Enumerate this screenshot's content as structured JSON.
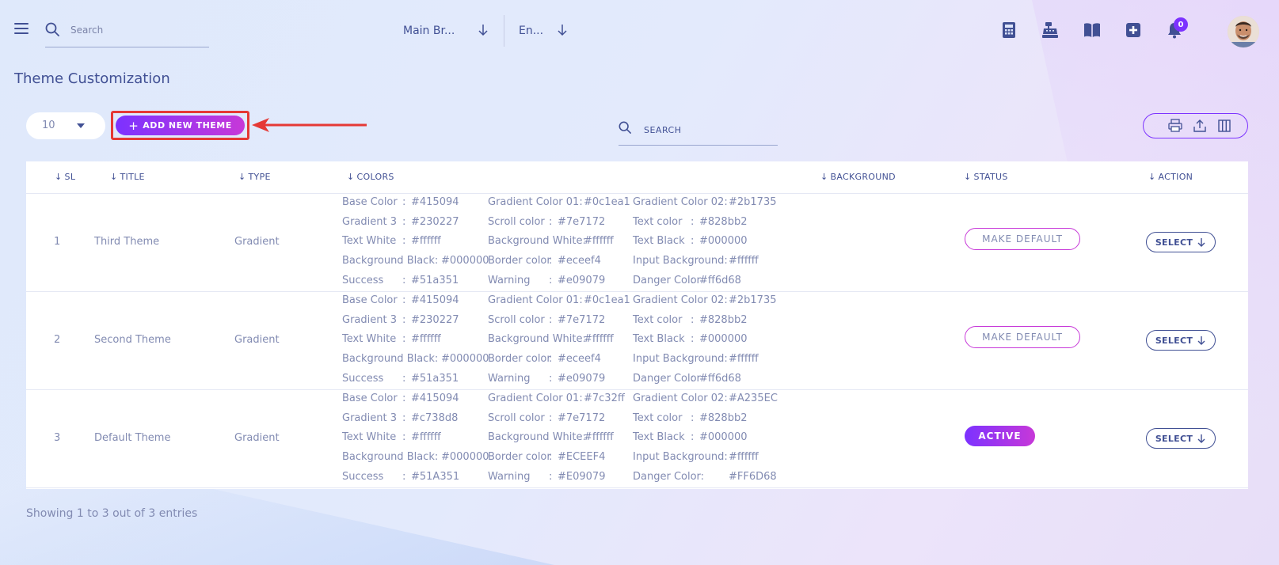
{
  "topbar": {
    "search_placeholder": "Search",
    "branch": "Main Br...",
    "language": "En...",
    "notification_count": "0",
    "icons": [
      "calculator-icon",
      "cash-register-icon",
      "book-icon",
      "plus-square-icon",
      "bell-icon"
    ]
  },
  "page": {
    "title": "Theme Customization"
  },
  "controls": {
    "per_page": "10",
    "add_button": "ADD NEW THEME",
    "add_button_plus": "+",
    "search_placeholder": "SEARCH"
  },
  "table": {
    "headers": {
      "sl": "SL",
      "title": "TITLE",
      "type": "TYPE",
      "colors": "COLORS",
      "background": "BACKGROUND",
      "status": "STATUS",
      "action": "ACTION"
    },
    "rows": [
      {
        "sl": "1",
        "title": "Third Theme",
        "type": "Gradient",
        "colors": [
          [
            "Base Color",
            "#415094"
          ],
          [
            "Gradient Color 01:",
            "#0c1ea1"
          ],
          [
            "Gradient Color 02:",
            "#2b1735"
          ],
          [
            "Gradient 3",
            "#230227"
          ],
          [
            "Scroll color",
            "#7e7172"
          ],
          [
            "Text color",
            "#828bb2"
          ],
          [
            "Text White",
            "#ffffff"
          ],
          [
            "Background White:",
            "#ffffff"
          ],
          [
            "Text Black",
            "#000000"
          ],
          [
            "Background Black:",
            "#000000"
          ],
          [
            "Border color",
            "#eceef4"
          ],
          [
            "Input Background:",
            "#ffffff"
          ],
          [
            "Success",
            "#51a351"
          ],
          [
            "Warning",
            "#e09079"
          ],
          [
            "Danger Color",
            "#ff6d68"
          ]
        ],
        "status": "MAKE DEFAULT",
        "status_active": false,
        "action": "SELECT"
      },
      {
        "sl": "2",
        "title": "Second Theme",
        "type": "Gradient",
        "colors": [
          [
            "Base Color",
            "#415094"
          ],
          [
            "Gradient Color 01:",
            "#0c1ea1"
          ],
          [
            "Gradient Color 02:",
            "#2b1735"
          ],
          [
            "Gradient 3",
            "#230227"
          ],
          [
            "Scroll color",
            "#7e7172"
          ],
          [
            "Text color",
            "#828bb2"
          ],
          [
            "Text White",
            "#ffffff"
          ],
          [
            "Background White:",
            "#ffffff"
          ],
          [
            "Text Black",
            "#000000"
          ],
          [
            "Background Black:",
            "#000000"
          ],
          [
            "Border color",
            "#eceef4"
          ],
          [
            "Input Background:",
            "#ffffff"
          ],
          [
            "Success",
            "#51a351"
          ],
          [
            "Warning",
            "#e09079"
          ],
          [
            "Danger Color",
            "#ff6d68"
          ]
        ],
        "status": "MAKE DEFAULT",
        "status_active": false,
        "action": "SELECT"
      },
      {
        "sl": "3",
        "title": "Default Theme",
        "type": "Gradient",
        "colors": [
          [
            "Base Color",
            "#415094"
          ],
          [
            "Gradient Color 01:",
            "#7c32ff"
          ],
          [
            "Gradient Color 02:",
            "#A235EC"
          ],
          [
            "Gradient 3",
            "#c738d8"
          ],
          [
            "Scroll color",
            "#7e7172"
          ],
          [
            "Text color",
            "#828bb2"
          ],
          [
            "Text White",
            "#ffffff"
          ],
          [
            "Background White:",
            "#ffffff"
          ],
          [
            "Text Black",
            "#000000"
          ],
          [
            "Background Black:",
            "#000000"
          ],
          [
            "Border color",
            "#ECEEF4"
          ],
          [
            "Input Background:",
            "#ffffff"
          ],
          [
            "Success",
            "#51A351"
          ],
          [
            "Warning",
            "#E09079"
          ],
          [
            "Danger Color:",
            "#FF6D68"
          ]
        ],
        "status": "ACTIVE",
        "status_active": true,
        "action": "SELECT"
      }
    ]
  },
  "footer": {
    "info": "Showing 1 to 3 out of 3 entries"
  },
  "theme_colors": {
    "primary": "#415094",
    "text_muted": "#828bb2",
    "gradient_start": "#7c32ff",
    "gradient_end": "#c738d8",
    "annotation_red": "#e53935"
  }
}
